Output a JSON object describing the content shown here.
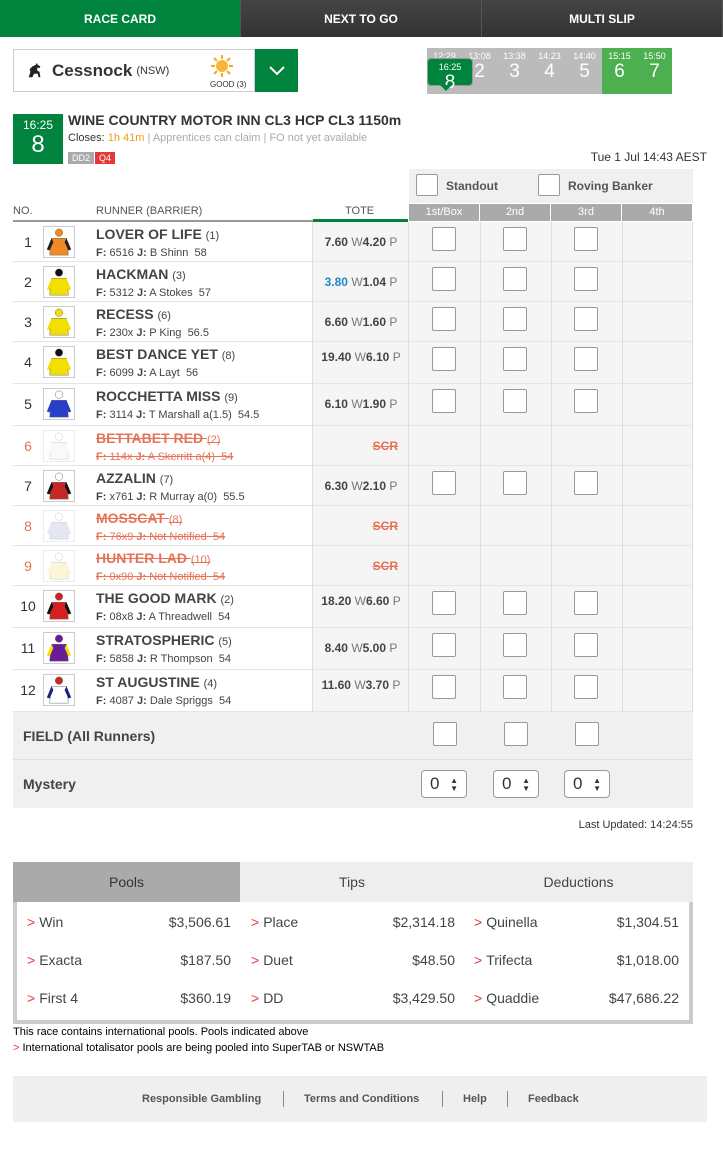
{
  "nav": {
    "tabs": [
      "RACE CARD",
      "NEXT TO GO",
      "MULTI SLIP"
    ]
  },
  "venue": {
    "name": "Cessnock",
    "state": "(NSW)",
    "going": "GOOD (3)"
  },
  "races": [
    {
      "time": "12:29",
      "num": "1"
    },
    {
      "time": "13:08",
      "num": "2"
    },
    {
      "time": "13:38",
      "num": "3"
    },
    {
      "time": "14:23",
      "num": "4"
    },
    {
      "time": "14:40",
      "num": "5"
    },
    {
      "time": "15:15",
      "num": "6"
    },
    {
      "time": "15:50",
      "num": "7"
    },
    {
      "time": "16:25",
      "num": "8"
    }
  ],
  "race": {
    "time": "16:25",
    "num": "8",
    "title": "WINE COUNTRY MOTOR INN CL3 HCP CL3 1150m",
    "closes_label": "Closes:",
    "closes_in": "1h 41m",
    "info": "| Apprentices can claim | FO not yet available",
    "tag_dd": "DD2",
    "tag_q": "Q4",
    "datetime": "Tue 1 Jul 14:43 AEST"
  },
  "options": {
    "standout": "Standout",
    "roving": "Roving Banker"
  },
  "headers": {
    "no": "NO.",
    "runner": "RUNNER (BARRIER)",
    "tote": "TOTE",
    "c1": "1st/Box",
    "c2": "2nd",
    "c3": "3rd",
    "c4": "4th"
  },
  "runners": [
    {
      "no": "1",
      "name": "LOVER OF LIFE",
      "barrier": "(1)",
      "form": "6516",
      "jockey": "B Shinn",
      "weight": "58",
      "win": "7.60",
      "place": "4.20",
      "scr": false
    },
    {
      "no": "2",
      "name": "HACKMAN",
      "barrier": "(3)",
      "form": "5312",
      "jockey": "A Stokes",
      "weight": "57",
      "win": "3.80",
      "place": "1.04",
      "scr": false
    },
    {
      "no": "3",
      "name": "RECESS",
      "barrier": "(6)",
      "form": "230x",
      "jockey": "P King",
      "weight": "56.5",
      "win": "6.60",
      "place": "1.60",
      "scr": false
    },
    {
      "no": "4",
      "name": "BEST DANCE YET",
      "barrier": "(8)",
      "form": "6099",
      "jockey": "A Layt",
      "weight": "56",
      "win": "19.40",
      "place": "6.10",
      "scr": false
    },
    {
      "no": "5",
      "name": "ROCCHETTA MISS",
      "barrier": "(9)",
      "form": "3114",
      "jockey": "T Marshall a(1.5)",
      "weight": "54.5",
      "win": "6.10",
      "place": "1.90",
      "scr": false
    },
    {
      "no": "6",
      "name": "BETTABET RED",
      "barrier": "(2)",
      "form": "114x",
      "jockey": "A Skerritt a(4)",
      "weight": "54",
      "scr": true
    },
    {
      "no": "7",
      "name": "AZZALIN",
      "barrier": "(7)",
      "form": "x761",
      "jockey": "R Murray a(0)",
      "weight": "55.5",
      "win": "6.30",
      "place": "2.10",
      "scr": false
    },
    {
      "no": "8",
      "name": "MOSSCAT",
      "barrier": "(8)",
      "form": "76x9",
      "jockey": "Not Notified",
      "weight": "54",
      "scr": true
    },
    {
      "no": "9",
      "name": "HUNTER LAD",
      "barrier": "(10)",
      "form": "0x90",
      "jockey": "Not Notified",
      "weight": "54",
      "scr": true
    },
    {
      "no": "10",
      "name": "THE GOOD MARK",
      "barrier": "(2)",
      "form": "08x8",
      "jockey": "A Threadwell",
      "weight": "54",
      "win": "18.20",
      "place": "6.60",
      "scr": false
    },
    {
      "no": "11",
      "name": "STRATOSPHERIC",
      "barrier": "(5)",
      "form": "5858",
      "jockey": "R Thompson",
      "weight": "54",
      "win": "8.40",
      "place": "5.00",
      "scr": false
    },
    {
      "no": "12",
      "name": "ST AUGUSTINE",
      "barrier": "(4)",
      "form": "4087",
      "jockey": "Dale Spriggs",
      "weight": "54",
      "win": "11.60",
      "place": "3.70",
      "scr": false
    }
  ],
  "labels": {
    "f": "F:",
    "j": "J:",
    "w": "W",
    "p": "P",
    "scr": "SCR"
  },
  "field_label": "FIELD (All Runners)",
  "mystery": {
    "label": "Mystery",
    "v1": "0",
    "v2": "0",
    "v3": "0"
  },
  "updated": "Last Updated: 14:24:55",
  "pools": {
    "tabs": [
      "Pools",
      "Tips",
      "Deductions"
    ],
    "items": [
      {
        "name": "Win",
        "value": "$3,506.61"
      },
      {
        "name": "Place",
        "value": "$2,314.18"
      },
      {
        "name": "Quinella",
        "value": "$1,304.51"
      },
      {
        "name": "Exacta",
        "value": "$187.50"
      },
      {
        "name": "Duet",
        "value": "$48.50"
      },
      {
        "name": "Trifecta",
        "value": "$1,018.00"
      },
      {
        "name": "First 4",
        "value": "$360.19"
      },
      {
        "name": "DD",
        "value": "$3,429.50"
      },
      {
        "name": "Quaddie",
        "value": "$47,686.22"
      }
    ]
  },
  "notes": {
    "n1": "This race contains international pools. Pools indicated above",
    "n2": "International totalisator pools are being pooled into SuperTAB or NSWTAB"
  },
  "footer": {
    "l1": "Responsible Gambling",
    "l2": "Terms and Conditions",
    "l3": "Help",
    "l4": "Feedback"
  },
  "colors": {
    "green": "#00843d",
    "accent": "#e53935",
    "scratched": "#e57358",
    "blue": "#1e88c7"
  },
  "silks": [
    {
      "body": "#f08a24",
      "sleeve": "#222",
      "cap": "#f08a24"
    },
    {
      "body": "#f4e000",
      "sleeve": "#f4e000",
      "cap": "#111"
    },
    {
      "body": "#f4e000",
      "sleeve": "#f4e000",
      "cap": "#f4e000"
    },
    {
      "body": "#f4e000",
      "sleeve": "#f4e000",
      "cap": "#111"
    },
    {
      "body": "#2a3fc9",
      "sleeve": "#2a3fc9",
      "cap": "#fff"
    },
    {
      "body": "#eee",
      "sleeve": "#eee",
      "cap": "#fff"
    },
    {
      "body": "#c62828",
      "sleeve": "#111",
      "cap": "#fff"
    },
    {
      "body": "#b0bde0",
      "sleeve": "#b0bde0",
      "cap": "#fff"
    },
    {
      "body": "#f4e890",
      "sleeve": "#f4e890",
      "cap": "#fff"
    },
    {
      "body": "#d62020",
      "sleeve": "#111",
      "cap": "#d62020"
    },
    {
      "body": "#6a1b9a",
      "sleeve": "#f4e000",
      "cap": "#6a1b9a"
    },
    {
      "body": "#fff",
      "sleeve": "#1a237e",
      "cap": "#c62828"
    }
  ]
}
